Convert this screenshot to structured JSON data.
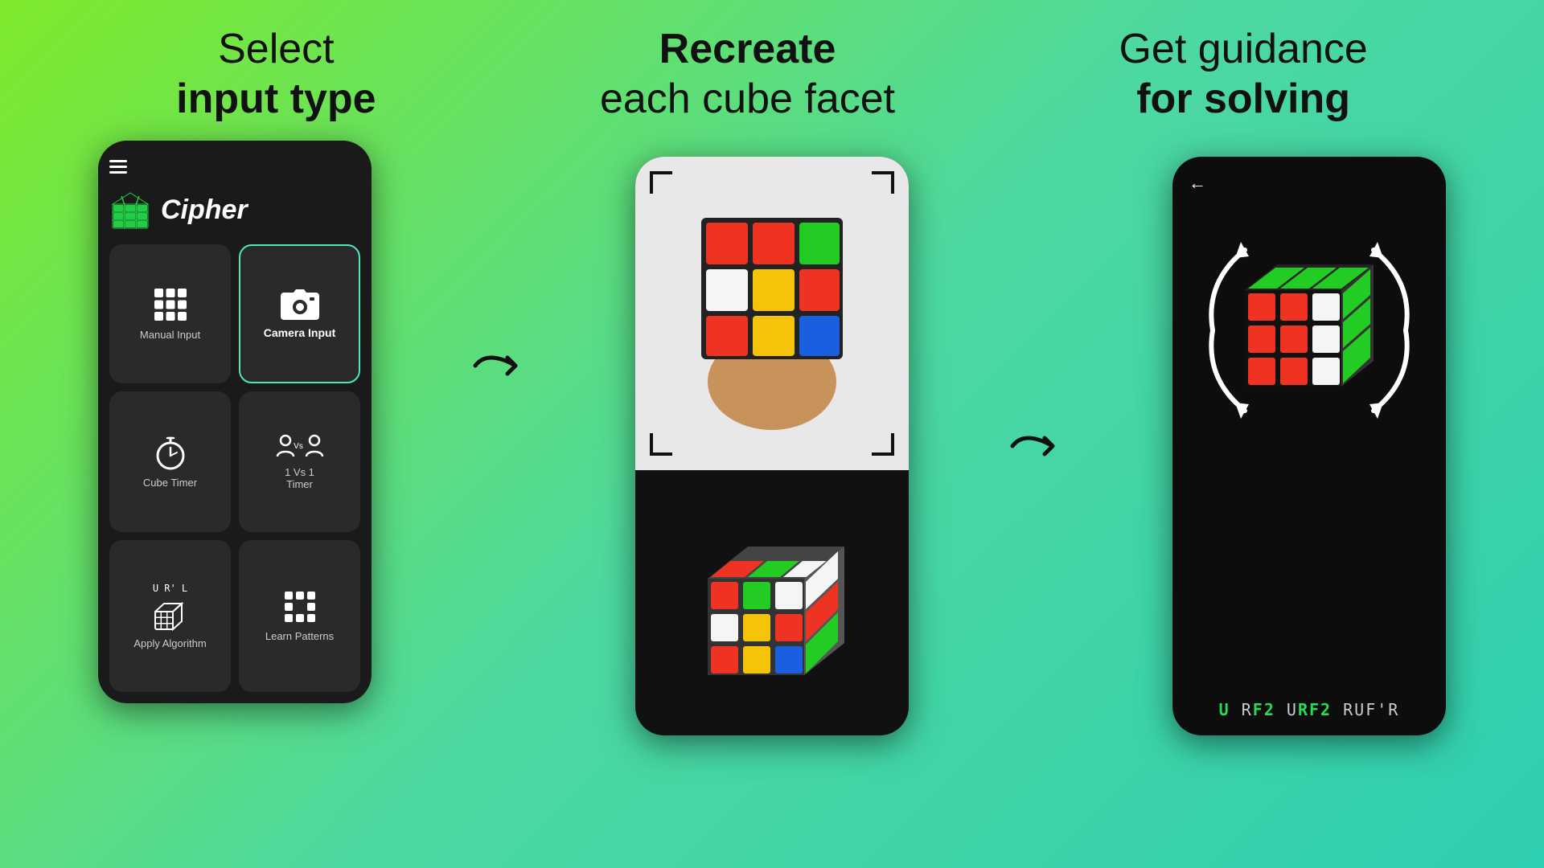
{
  "header": {
    "col1_line1": "Select",
    "col1_line2": "input type",
    "col2_line1": "Recreate",
    "col2_line2": "each cube facet",
    "col3_line1": "Get guidance",
    "col3_line2": "for solving"
  },
  "phone1": {
    "app_name": "Cipher",
    "menu_icon": "hamburger-icon",
    "buttons": [
      {
        "id": "manual-input",
        "label": "Manual Input",
        "icon": "grid-icon",
        "selected": false
      },
      {
        "id": "camera-input",
        "label": "Camera Input",
        "icon": "camera-icon",
        "selected": true
      },
      {
        "id": "cube-timer",
        "label": "Cube Timer",
        "icon": "timer-icon",
        "selected": false
      },
      {
        "id": "1v1-timer",
        "label": "1 Vs 1\nTimer",
        "icon": "vs-icon",
        "selected": false
      },
      {
        "id": "apply-algorithm",
        "label": "Apply Algorithm",
        "icon": "algo-icon",
        "selected": false
      },
      {
        "id": "learn-patterns",
        "label": "Learn Patterns",
        "icon": "dots-icon",
        "selected": false
      }
    ]
  },
  "phone2": {
    "top_face_colors": [
      "red",
      "red",
      "green",
      "white",
      "yellow",
      "red",
      "red",
      "yellow",
      "blue"
    ],
    "bottom_face_colors": [
      "red",
      "green",
      "white",
      "white",
      "yellow",
      "red",
      "red",
      "yellow",
      "blue"
    ]
  },
  "phone3": {
    "algorithm": "URF2URF2RUF'R",
    "back_label": "←"
  },
  "colors": {
    "background_start": "#7eea2a",
    "background_end": "#2ecfb0",
    "accent_green": "#4de8c0",
    "app_green": "#22cc44"
  }
}
